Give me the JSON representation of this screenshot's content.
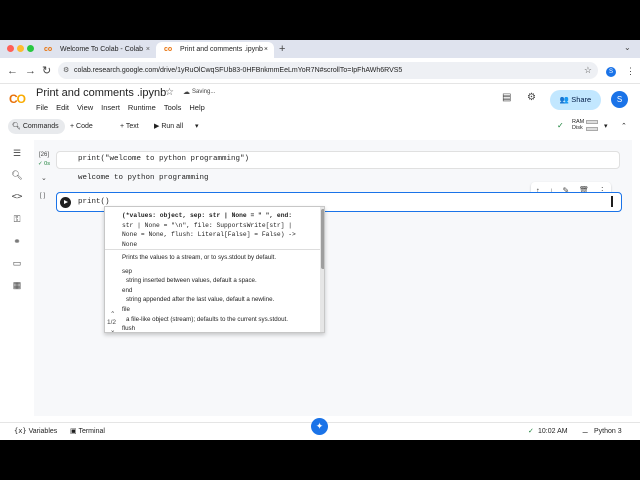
{
  "browser": {
    "tabs": [
      {
        "label": "Welcome To Colab - Colab",
        "close": "×"
      },
      {
        "label": "Print and comments .ipynb -",
        "close": "×"
      }
    ],
    "new_tab": "+",
    "url": "colab.research.google.com/drive/1yRuOlCwqSFUb83-0HFBnkmmEeLmYoR7N#scrollTo=IpFhAWh6RVS5",
    "extension_badge": "S"
  },
  "colab": {
    "logo": "CO",
    "notebook_title": "Print and comments .ipynb",
    "saving": "Saving...",
    "menu": [
      "File",
      "Edit",
      "View",
      "Insert",
      "Runtime",
      "Tools",
      "Help"
    ],
    "share": "Share",
    "avatar": "S"
  },
  "toolbar": {
    "commands": "Commands",
    "add_code": "+ Code",
    "add_text": "+ Text",
    "run_all": "Run all",
    "ram": "RAM",
    "disk": "Disk"
  },
  "cells": [
    {
      "exec_count": "[26]",
      "duration": "0s",
      "code": "print(\"welcome to python programming\")",
      "output": "welcome to python programming"
    },
    {
      "exec_count": "[ ]",
      "code": "print()"
    }
  ],
  "autocomplete": {
    "signature": [
      "(*values: object, sep: str | None = \" \", end:",
      "str | None = \"\\n\", file: SupportsWrite[str] |",
      "None = None, flush: Literal[False] = False) ->",
      "None"
    ],
    "description": "Prints the values to a stream, or to sys.stdout by default.",
    "params": [
      {
        "name": "sep",
        "desc": "string inserted between values, default a space."
      },
      {
        "name": "end",
        "desc": "string appended after the last value, default a newline."
      },
      {
        "name": "file",
        "desc": "a file-like object (stream); defaults to the current sys.stdout."
      },
      {
        "name": "flush",
        "desc": ""
      }
    ],
    "paging": "1/2"
  },
  "statusbar": {
    "variables": "Variables",
    "terminal": "Terminal",
    "time": "10:02 AM",
    "runtime": "Python 3"
  }
}
